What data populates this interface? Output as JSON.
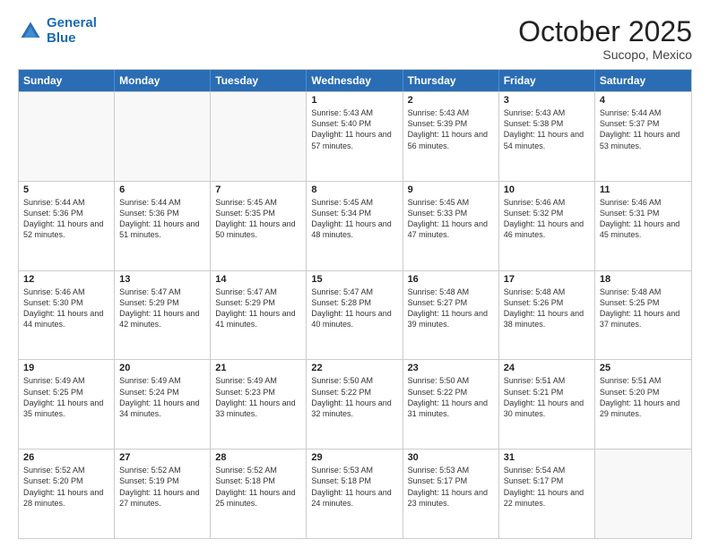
{
  "header": {
    "logo_line1": "General",
    "logo_line2": "Blue",
    "month": "October 2025",
    "location": "Sucopo, Mexico"
  },
  "weekdays": [
    "Sunday",
    "Monday",
    "Tuesday",
    "Wednesday",
    "Thursday",
    "Friday",
    "Saturday"
  ],
  "rows": [
    [
      {
        "day": "",
        "sunrise": "",
        "sunset": "",
        "daylight": ""
      },
      {
        "day": "",
        "sunrise": "",
        "sunset": "",
        "daylight": ""
      },
      {
        "day": "",
        "sunrise": "",
        "sunset": "",
        "daylight": ""
      },
      {
        "day": "1",
        "sunrise": "Sunrise: 5:43 AM",
        "sunset": "Sunset: 5:40 PM",
        "daylight": "Daylight: 11 hours and 57 minutes."
      },
      {
        "day": "2",
        "sunrise": "Sunrise: 5:43 AM",
        "sunset": "Sunset: 5:39 PM",
        "daylight": "Daylight: 11 hours and 56 minutes."
      },
      {
        "day": "3",
        "sunrise": "Sunrise: 5:43 AM",
        "sunset": "Sunset: 5:38 PM",
        "daylight": "Daylight: 11 hours and 54 minutes."
      },
      {
        "day": "4",
        "sunrise": "Sunrise: 5:44 AM",
        "sunset": "Sunset: 5:37 PM",
        "daylight": "Daylight: 11 hours and 53 minutes."
      }
    ],
    [
      {
        "day": "5",
        "sunrise": "Sunrise: 5:44 AM",
        "sunset": "Sunset: 5:36 PM",
        "daylight": "Daylight: 11 hours and 52 minutes."
      },
      {
        "day": "6",
        "sunrise": "Sunrise: 5:44 AM",
        "sunset": "Sunset: 5:36 PM",
        "daylight": "Daylight: 11 hours and 51 minutes."
      },
      {
        "day": "7",
        "sunrise": "Sunrise: 5:45 AM",
        "sunset": "Sunset: 5:35 PM",
        "daylight": "Daylight: 11 hours and 50 minutes."
      },
      {
        "day": "8",
        "sunrise": "Sunrise: 5:45 AM",
        "sunset": "Sunset: 5:34 PM",
        "daylight": "Daylight: 11 hours and 48 minutes."
      },
      {
        "day": "9",
        "sunrise": "Sunrise: 5:45 AM",
        "sunset": "Sunset: 5:33 PM",
        "daylight": "Daylight: 11 hours and 47 minutes."
      },
      {
        "day": "10",
        "sunrise": "Sunrise: 5:46 AM",
        "sunset": "Sunset: 5:32 PM",
        "daylight": "Daylight: 11 hours and 46 minutes."
      },
      {
        "day": "11",
        "sunrise": "Sunrise: 5:46 AM",
        "sunset": "Sunset: 5:31 PM",
        "daylight": "Daylight: 11 hours and 45 minutes."
      }
    ],
    [
      {
        "day": "12",
        "sunrise": "Sunrise: 5:46 AM",
        "sunset": "Sunset: 5:30 PM",
        "daylight": "Daylight: 11 hours and 44 minutes."
      },
      {
        "day": "13",
        "sunrise": "Sunrise: 5:47 AM",
        "sunset": "Sunset: 5:29 PM",
        "daylight": "Daylight: 11 hours and 42 minutes."
      },
      {
        "day": "14",
        "sunrise": "Sunrise: 5:47 AM",
        "sunset": "Sunset: 5:29 PM",
        "daylight": "Daylight: 11 hours and 41 minutes."
      },
      {
        "day": "15",
        "sunrise": "Sunrise: 5:47 AM",
        "sunset": "Sunset: 5:28 PM",
        "daylight": "Daylight: 11 hours and 40 minutes."
      },
      {
        "day": "16",
        "sunrise": "Sunrise: 5:48 AM",
        "sunset": "Sunset: 5:27 PM",
        "daylight": "Daylight: 11 hours and 39 minutes."
      },
      {
        "day": "17",
        "sunrise": "Sunrise: 5:48 AM",
        "sunset": "Sunset: 5:26 PM",
        "daylight": "Daylight: 11 hours and 38 minutes."
      },
      {
        "day": "18",
        "sunrise": "Sunrise: 5:48 AM",
        "sunset": "Sunset: 5:25 PM",
        "daylight": "Daylight: 11 hours and 37 minutes."
      }
    ],
    [
      {
        "day": "19",
        "sunrise": "Sunrise: 5:49 AM",
        "sunset": "Sunset: 5:25 PM",
        "daylight": "Daylight: 11 hours and 35 minutes."
      },
      {
        "day": "20",
        "sunrise": "Sunrise: 5:49 AM",
        "sunset": "Sunset: 5:24 PM",
        "daylight": "Daylight: 11 hours and 34 minutes."
      },
      {
        "day": "21",
        "sunrise": "Sunrise: 5:49 AM",
        "sunset": "Sunset: 5:23 PM",
        "daylight": "Daylight: 11 hours and 33 minutes."
      },
      {
        "day": "22",
        "sunrise": "Sunrise: 5:50 AM",
        "sunset": "Sunset: 5:22 PM",
        "daylight": "Daylight: 11 hours and 32 minutes."
      },
      {
        "day": "23",
        "sunrise": "Sunrise: 5:50 AM",
        "sunset": "Sunset: 5:22 PM",
        "daylight": "Daylight: 11 hours and 31 minutes."
      },
      {
        "day": "24",
        "sunrise": "Sunrise: 5:51 AM",
        "sunset": "Sunset: 5:21 PM",
        "daylight": "Daylight: 11 hours and 30 minutes."
      },
      {
        "day": "25",
        "sunrise": "Sunrise: 5:51 AM",
        "sunset": "Sunset: 5:20 PM",
        "daylight": "Daylight: 11 hours and 29 minutes."
      }
    ],
    [
      {
        "day": "26",
        "sunrise": "Sunrise: 5:52 AM",
        "sunset": "Sunset: 5:20 PM",
        "daylight": "Daylight: 11 hours and 28 minutes."
      },
      {
        "day": "27",
        "sunrise": "Sunrise: 5:52 AM",
        "sunset": "Sunset: 5:19 PM",
        "daylight": "Daylight: 11 hours and 27 minutes."
      },
      {
        "day": "28",
        "sunrise": "Sunrise: 5:52 AM",
        "sunset": "Sunset: 5:18 PM",
        "daylight": "Daylight: 11 hours and 25 minutes."
      },
      {
        "day": "29",
        "sunrise": "Sunrise: 5:53 AM",
        "sunset": "Sunset: 5:18 PM",
        "daylight": "Daylight: 11 hours and 24 minutes."
      },
      {
        "day": "30",
        "sunrise": "Sunrise: 5:53 AM",
        "sunset": "Sunset: 5:17 PM",
        "daylight": "Daylight: 11 hours and 23 minutes."
      },
      {
        "day": "31",
        "sunrise": "Sunrise: 5:54 AM",
        "sunset": "Sunset: 5:17 PM",
        "daylight": "Daylight: 11 hours and 22 minutes."
      },
      {
        "day": "",
        "sunrise": "",
        "sunset": "",
        "daylight": ""
      }
    ]
  ]
}
